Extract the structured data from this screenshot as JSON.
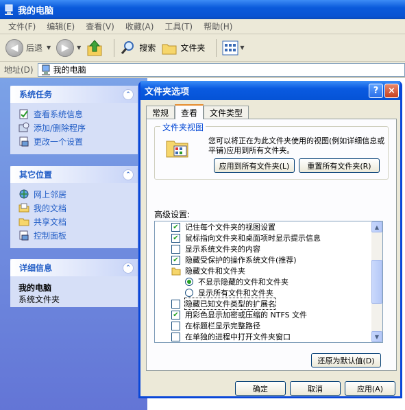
{
  "window": {
    "title": "我的电脑"
  },
  "menu": [
    "文件(F)",
    "编辑(E)",
    "查看(V)",
    "收藏(A)",
    "工具(T)",
    "帮助(H)"
  ],
  "toolbar": {
    "back": "后退",
    "search": "搜索",
    "folders": "文件夹"
  },
  "address": {
    "label": "地址(D)",
    "value": "我的电脑"
  },
  "sidebar": {
    "tasks": {
      "title": "系统任务",
      "items": [
        "查看系统信息",
        "添加/删除程序",
        "更改一个设置"
      ]
    },
    "places": {
      "title": "其它位置",
      "items": [
        "网上邻居",
        "我的文档",
        "共享文档",
        "控制面板"
      ]
    },
    "details": {
      "title": "详细信息",
      "name": "我的电脑",
      "desc": "系统文件夹"
    }
  },
  "dialog": {
    "title": "文件夹选项",
    "help": "?",
    "close": "×",
    "tabs": [
      "常规",
      "查看",
      "文件类型"
    ],
    "folder_view": {
      "title": "文件夹视图",
      "desc": "您可以将正在为此文件夹使用的视图(例如详细信息或平铺)应用到所有文件夹。",
      "apply_all": "应用到所有文件夹(L)",
      "reset_all": "重置所有文件夹(R)"
    },
    "advanced_label": "高级设置:",
    "settings": [
      {
        "type": "checkbox",
        "checked": true,
        "label": "记住每个文件夹的视图设置"
      },
      {
        "type": "checkbox",
        "checked": true,
        "label": "鼠标指向文件夹和桌面项时显示提示信息"
      },
      {
        "type": "checkbox",
        "checked": false,
        "label": "显示系统文件夹的内容"
      },
      {
        "type": "checkbox",
        "checked": true,
        "label": "隐藏受保护的操作系统文件(推荐)"
      },
      {
        "type": "folder",
        "label": "隐藏文件和文件夹"
      },
      {
        "type": "radio",
        "checked": true,
        "label": "不显示隐藏的文件和文件夹"
      },
      {
        "type": "radio",
        "checked": false,
        "label": "显示所有文件和文件夹"
      },
      {
        "type": "checkbox",
        "checked": false,
        "selected": true,
        "label": "隐藏已知文件类型的扩展名"
      },
      {
        "type": "checkbox",
        "checked": true,
        "label": "用彩色显示加密或压缩的 NTFS 文件"
      },
      {
        "type": "checkbox",
        "checked": false,
        "label": "在标题栏显示完整路径"
      },
      {
        "type": "checkbox",
        "checked": false,
        "label": "在单独的进程中打开文件夹窗口"
      }
    ],
    "restore_defaults": "还原为默认值(D)",
    "ok": "确定",
    "cancel": "取消",
    "apply": "应用(A)"
  }
}
